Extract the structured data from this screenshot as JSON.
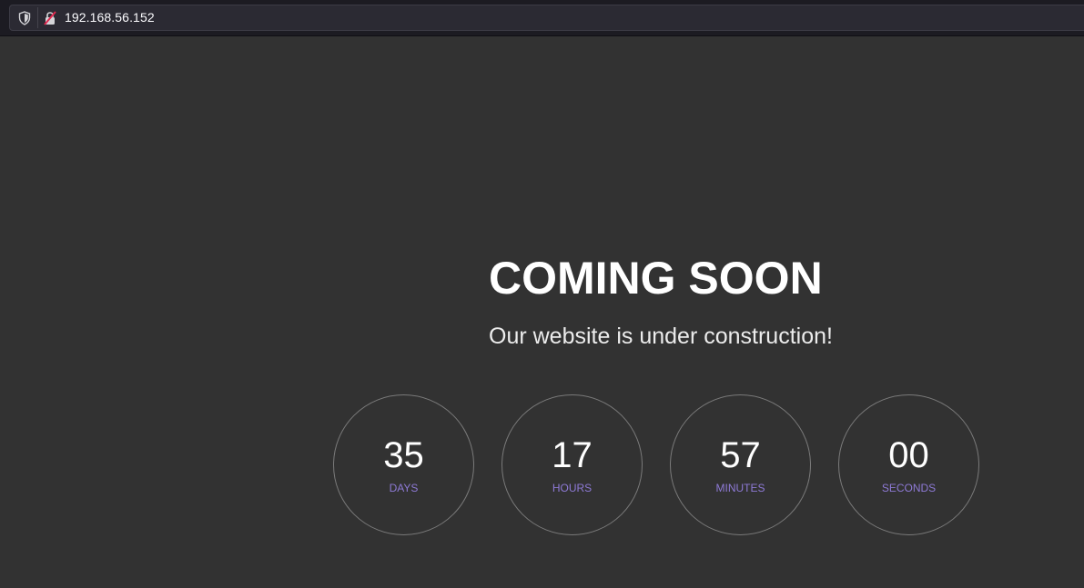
{
  "browser": {
    "url": "192.168.56.152",
    "shield_icon": "shield-icon",
    "lock_icon": "insecure-lock-icon"
  },
  "hero": {
    "title": "COMING SOON",
    "subtitle": "Our website is under construction!"
  },
  "countdown": {
    "days": {
      "value": "35",
      "label": "DAYS"
    },
    "hours": {
      "value": "17",
      "label": "HOURS"
    },
    "minutes": {
      "value": "57",
      "label": "MINUTES"
    },
    "seconds": {
      "value": "00",
      "label": "SECONDS"
    }
  },
  "colors": {
    "background": "#323232",
    "accent": "#8e7ad6",
    "text": "#ffffff"
  }
}
